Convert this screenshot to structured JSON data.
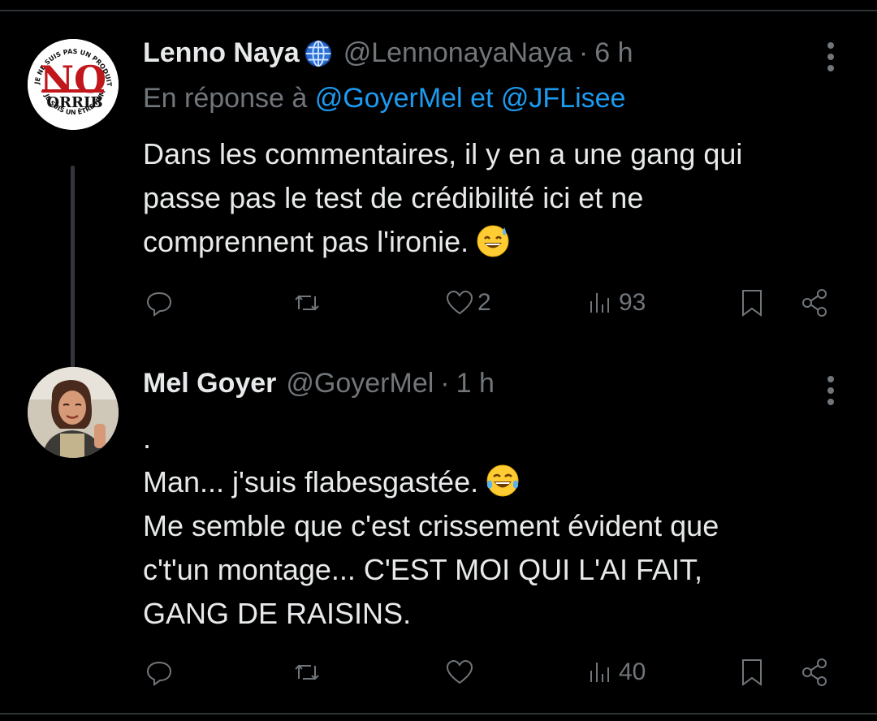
{
  "tweets": [
    {
      "name": "Lenno Naya",
      "handle": "@LennonayaNaya",
      "separator": "·",
      "time": "6 h",
      "reply_prefix": "En réponse à",
      "reply_user1": "@GoyerMel",
      "reply_conj": "et",
      "reply_user2": "@JFLisee",
      "text": "Dans les commentaires, il y en a une gang qui\npasse pas le test de crédibilité ici et ne\ncomprennent pas l'ironie.",
      "emoji": "sweat-smile-emoji",
      "avatar_text_top": "JE NE SUIS PAS UN PRODUIT",
      "avatar_text_bottom": "JE SUIS UN ÊTRE HUMAIN",
      "avatar_main": "NO",
      "avatar_sub": "ORRIB",
      "likes": "2",
      "views": "93"
    },
    {
      "name": "Mel Goyer",
      "handle": "@GoyerMel",
      "separator": "·",
      "time": "1 h",
      "text": ".\nMan... j'suis flabesgastée.",
      "text2": "\nMe semble que c'est crissement évident que\nc't'un montage... C'EST MOI QUI L'AI FAIT,\nGANG DE RAISINS.",
      "emoji": "tears-of-joy-emoji",
      "views": "40"
    }
  ],
  "colors": {
    "background": "#000000",
    "text": "#e7e9ea",
    "muted": "#71767b",
    "link": "#1d9bf0"
  }
}
